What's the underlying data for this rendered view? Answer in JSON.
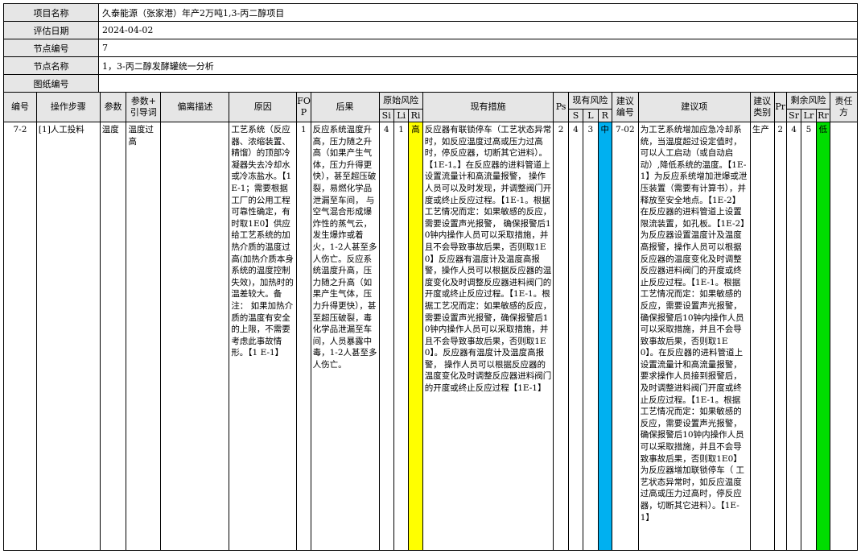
{
  "info": {
    "project_name_label": "项目名称",
    "project_name": "久泰能源（张家港）年产2万吨1,3-丙二醇项目",
    "date_label": "评估日期",
    "date": "2024-04-02",
    "node_no_label": "节点编号",
    "node_no": "7",
    "node_name_label": "节点名称",
    "node_name": "1，3-丙二醇发酵罐统一分析",
    "drawing_no_label": "图纸编号",
    "drawing_no": ""
  },
  "headers": {
    "no": "编号",
    "step": "操作步骤",
    "param": "参数",
    "guide": "参数+\n引导词",
    "deviation": "偏离描述",
    "cause": "原因",
    "fop": "FO\nP",
    "consequence": "后果",
    "orig_risk": "原始风险",
    "si": "Si",
    "li": "Li",
    "ri": "Ri",
    "measures": "现有措施",
    "ps": "Ps",
    "cur_risk": "现有风险",
    "s": "S",
    "l": "L",
    "r": "R",
    "rec_no": "建议\n编号",
    "rec": "建议项",
    "rec_type": "建议\n类别",
    "pr": "Pr",
    "rem_risk": "剩余风险",
    "sr": "Sr",
    "lr": "Lr",
    "rr": "Rr",
    "owner": "责任\n方"
  },
  "row": {
    "no": "7-2",
    "step": "[1]人工投料",
    "param": "温度",
    "guide": "温度过高",
    "deviation": "",
    "cause": "工艺系统（反应器、浓缩装置、精馏）的顶部冷凝器失去冷却水或冷冻盐水。【1 E-1；需要根据工厂的公用工程可靠性确定，有时取1E0】供应给工艺系统的加热介质的温度过高(加热介质本身系统的温度控制失效)，加热时的温差较大。备注： 如果加热介质的温度有安全的上限，不需要考虑此事故情形。【1 E-1】",
    "fop": "1",
    "consequence": "反应系统温度升高，压力随之升高（如果产生气体，压力升得更快），甚至超压破裂，易燃化学品泄漏至车间， 与空气混合形成爆炸性的蒸气云，发生爆炸或着火，1-2人甚至多人伤亡。反应系统温度升高，压力随之升高（如果产生气体，压力升得更快），甚至超压破裂，毒化学品泄漏至车间，人员暴露中毒，1-2人甚至多人伤亡。",
    "si": "4",
    "li": "1",
    "ri": "高",
    "measures": "反应器有联锁停车（工艺状态异常时，如反应温度过高或压力过高时，停反应器，切断其它进料）。【1E-1。】在反应器的进料管道上设置流量计和高流量报警， 操作人员可以及时发现，并调整阀门开度或终止反应过程。【1E-1。根据工艺情况而定：如果敏感的反应，需要设置声光报警， 确保报警后10钟内操作人员可以采取措施，并且不会导致事故后果，否则取1E0】反应器有温度计及温度高报警，操作人员可以根据反应器的温度变化及时调整反应器进料阀门的开度或终止反应过程。【1E-1。根据工艺况而定：如果敏感的反应，需要设置声光报警，确保报警后10钟内操作人员可以采取措施，并且不会导致事故后果，否则取1E0】。反应器有温度计及温度高报警， 操作人员可以根据反应器的温度变化及时调整反应器进料阀门的开度或终止反应过程【1E-1】",
    "ps": "2",
    "s": "4",
    "l": "3",
    "r": "中",
    "rec_no": "7-02",
    "rec": "为工艺系统增加应急冷却系统，当温度超过设定值时， 可以人工启动（或自动启动）,降低系统的温度。【1E-1】为反应系统增加泄爆或泄压装置（需要有计算书），并释放至安全地点。【1E-2】在反应器的进料管道上设置限流装置，如孔板。【1E-2】为反应器设置温度计及温度高报警，操作人员可以根据反应器的温度变化及时调整反应器进料阀门的开度或终止反应过程。【1E-1。根据工艺情况而定：如果敏感的反应，需要设置声光报警，确保报警后10钟内操作人员可以采取措施，并且不会导致事故后果，否则取1E 0】。在反应器的进料管道上设置流量计和高流量报警，要求操作人员接到报警后，及时调整进料阀门开度或终止反应过程。【1E-1。根据工艺情况而定：如果敏感的反应，需要设置声光报警，确保报警后10钟内操作人员可以采取措施，并且不会导致事故后果，否则取1E0】为反应器增加联锁停车（ 工艺状态异常时，如反应温度过高或压力过高时，停反应器，切断其它进料）。【1E-1】",
    "rec_type": "生产",
    "pr": "2",
    "sr": "4",
    "lr": "5",
    "rr": "低",
    "owner": ""
  },
  "colors": {
    "header_bg": "#e6e6e6",
    "ri_high": "#ffff00",
    "r_medium": "#00b0f0",
    "rr_low": "#00dd00"
  }
}
